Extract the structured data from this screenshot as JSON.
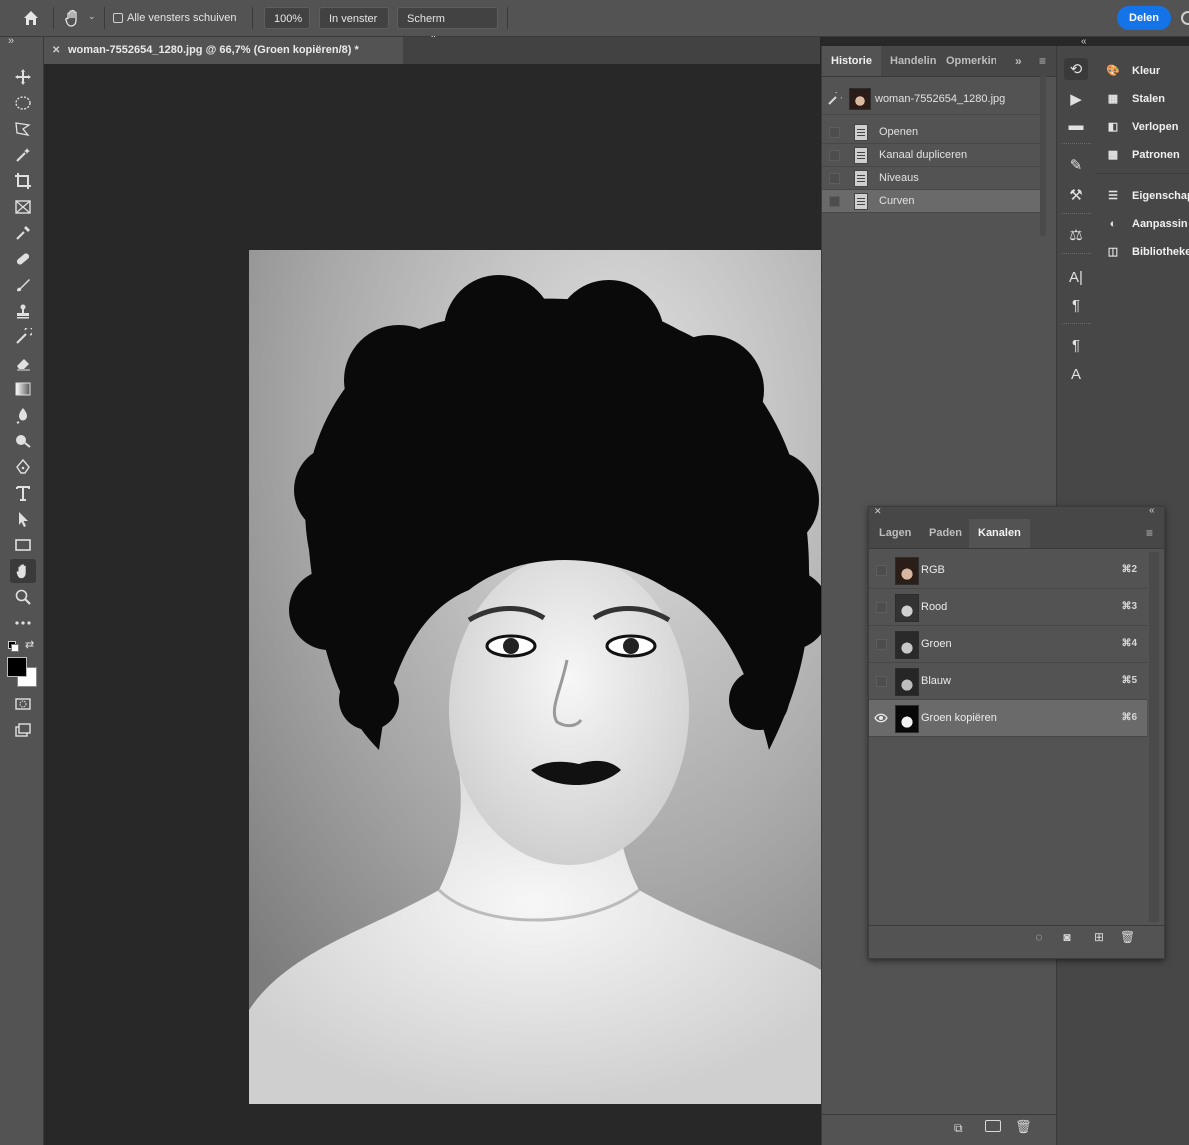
{
  "options_bar": {
    "checkbox_label": "Alle vensters schuiven",
    "btn_zoom": "100%",
    "btn_fit": "In venster",
    "btn_fill": "Scherm opvullen",
    "share_label": "Delen"
  },
  "document": {
    "tab_title": "woman-7552654_1280.jpg @ 66,7% (Groen kopiëren/8) *"
  },
  "history_panel": {
    "tabs": [
      "Historie",
      "Handelin",
      "Opmerkin"
    ],
    "snapshot": "woman-7552654_1280.jpg",
    "states": [
      "Openen",
      "Kanaal dupliceren",
      "Niveaus",
      "Curven"
    ],
    "selected_state": "Curven"
  },
  "right_panels": {
    "items": [
      "Kleur",
      "Stalen",
      "Verlopen",
      "Patronen",
      "Eigenschap",
      "Aanpassin",
      "Bibliotheke"
    ]
  },
  "channels_panel": {
    "tabs": [
      "Lagen",
      "Paden",
      "Kanalen"
    ],
    "active_tab": "Kanalen",
    "channels": [
      {
        "name": "RGB",
        "shortcut": "⌘2",
        "visible": false
      },
      {
        "name": "Rood",
        "shortcut": "⌘3",
        "visible": false
      },
      {
        "name": "Groen",
        "shortcut": "⌘4",
        "visible": false
      },
      {
        "name": "Blauw",
        "shortcut": "⌘5",
        "visible": false
      },
      {
        "name": "Groen kopiëren",
        "shortcut": "⌘6",
        "visible": true
      }
    ]
  },
  "colors": {
    "accent": "#1473e6",
    "panel": "#535353",
    "canvas_bg": "#282828"
  }
}
